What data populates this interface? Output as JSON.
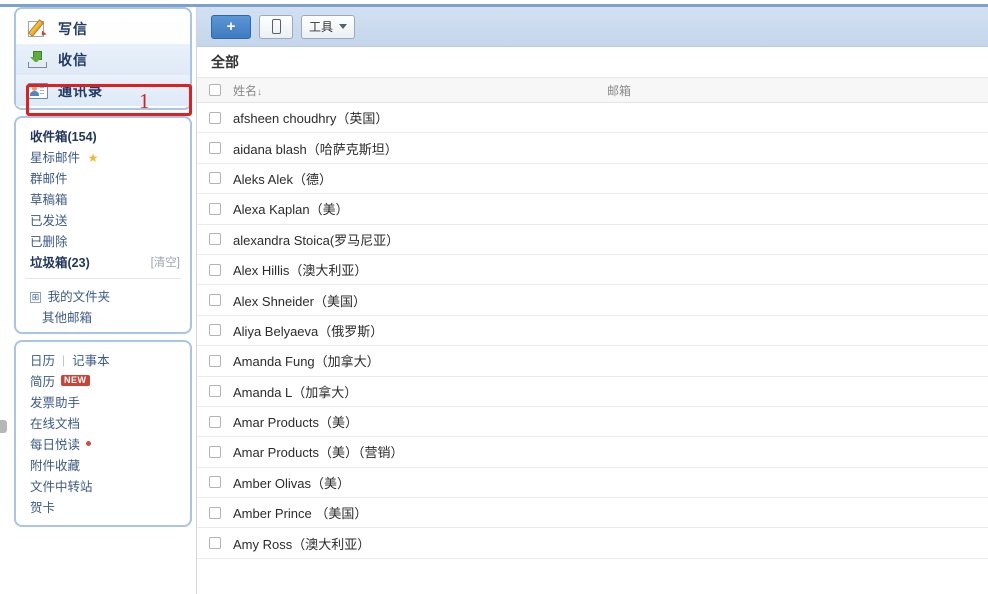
{
  "nav": {
    "items": [
      {
        "label": "写信",
        "icon": "compose-pencil-icon"
      },
      {
        "label": "收信",
        "icon": "receive-download-icon"
      },
      {
        "label": "通讯录",
        "icon": "contacts-card-icon"
      }
    ]
  },
  "folders": [
    {
      "label": "收件箱(154)",
      "bold": true,
      "star": false,
      "action": ""
    },
    {
      "label": "星标邮件",
      "bold": false,
      "star": true,
      "action": ""
    },
    {
      "label": "群邮件",
      "bold": false,
      "star": false,
      "action": ""
    },
    {
      "label": "草稿箱",
      "bold": false,
      "star": false,
      "action": ""
    },
    {
      "label": "已发送",
      "bold": false,
      "star": false,
      "action": ""
    },
    {
      "label": "已删除",
      "bold": false,
      "star": false,
      "action": ""
    },
    {
      "label": "垃圾箱(23)",
      "bold": true,
      "star": false,
      "action": "[清空]"
    }
  ],
  "my_folders": {
    "label": "我的文件夹",
    "expander": "⊞"
  },
  "other_mailbox": {
    "label": "其他邮箱"
  },
  "tools": {
    "row_calendar": {
      "left": "日历",
      "sep": "|",
      "right": "记事本"
    },
    "items": [
      {
        "label": "简历",
        "badge": "NEW",
        "dot": false
      },
      {
        "label": "发票助手",
        "badge": "",
        "dot": false
      },
      {
        "label": "在线文档",
        "badge": "",
        "dot": false
      },
      {
        "label": "每日悦读",
        "badge": "",
        "dot": true
      },
      {
        "label": "附件收藏",
        "badge": "",
        "dot": false
      },
      {
        "label": "文件中转站",
        "badge": "",
        "dot": false
      },
      {
        "label": "贺卡",
        "badge": "",
        "dot": false
      }
    ]
  },
  "annotation": {
    "number": "1",
    "color": "#e02020"
  },
  "toolbar": {
    "add_label": "+",
    "phone_label": "",
    "tools_label": "工具"
  },
  "main": {
    "group_title": "全部",
    "columns": {
      "name": "姓名",
      "sort_arrow": "↓",
      "email": "邮箱"
    },
    "contacts": [
      {
        "name": "afsheen choudhry（英国）",
        "email": ""
      },
      {
        "name": "aidana blash（哈萨克斯坦）",
        "email": ""
      },
      {
        "name": "Aleks Alek（德）",
        "email": ""
      },
      {
        "name": " Alexa Kaplan（美）",
        "email": ""
      },
      {
        "name": "alexandra Stoica(罗马尼亚）",
        "email": ""
      },
      {
        "name": "Alex Hillis（澳大利亚）",
        "email": ""
      },
      {
        "name": "Alex Shneider（美国）",
        "email": ""
      },
      {
        "name": "Aliya Belyaeva（俄罗斯）",
        "email": ""
      },
      {
        "name": "Amanda Fung（加拿大）",
        "email": ""
      },
      {
        "name": "Amanda L（加拿大）",
        "email": ""
      },
      {
        "name": "Amar Products（美）",
        "email": ""
      },
      {
        "name": "Amar Products（美）（营销）",
        "email": ""
      },
      {
        "name": " Amber Olivas（美）",
        "email": ""
      },
      {
        "name": "Amber Prince  （美国）",
        "email": ""
      },
      {
        "name": "Amy Ross（澳大利亚）",
        "email": ""
      }
    ]
  }
}
